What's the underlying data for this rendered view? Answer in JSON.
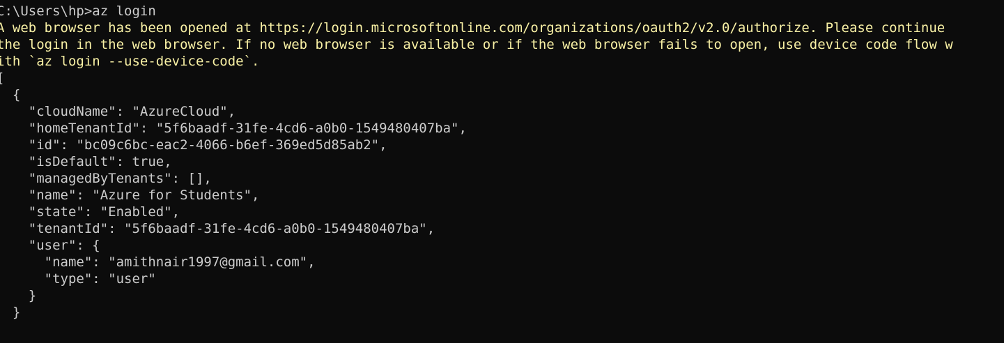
{
  "terminal": {
    "prompt_line": "C:\\Users\\hp>az login",
    "warning_lines": [
      "A web browser has been opened at https://login.microsoftonline.com/organizations/oauth2/v2.0/authorize. Please continue",
      "the login in the web browser. If no web browser is available or if the web browser fails to open, use device code flow w",
      "ith `az login --use-device-code`."
    ],
    "output_lines": [
      "[",
      "  {",
      "    \"cloudName\": \"AzureCloud\",",
      "    \"homeTenantId\": \"5f6baadf-31fe-4cd6-a0b0-1549480407ba\",",
      "    \"id\": \"bc09c6bc-eac2-4066-b6ef-369ed5d85ab2\",",
      "    \"isDefault\": true,",
      "    \"managedByTenants\": [],",
      "    \"name\": \"Azure for Students\",",
      "    \"state\": \"Enabled\",",
      "    \"tenantId\": \"5f6baadf-31fe-4cd6-a0b0-1549480407ba\",",
      "    \"user\": {",
      "      \"name\": \"amithnair1997@gmail.com\",",
      "      \"type\": \"user\"",
      "    }",
      "  }"
    ]
  }
}
